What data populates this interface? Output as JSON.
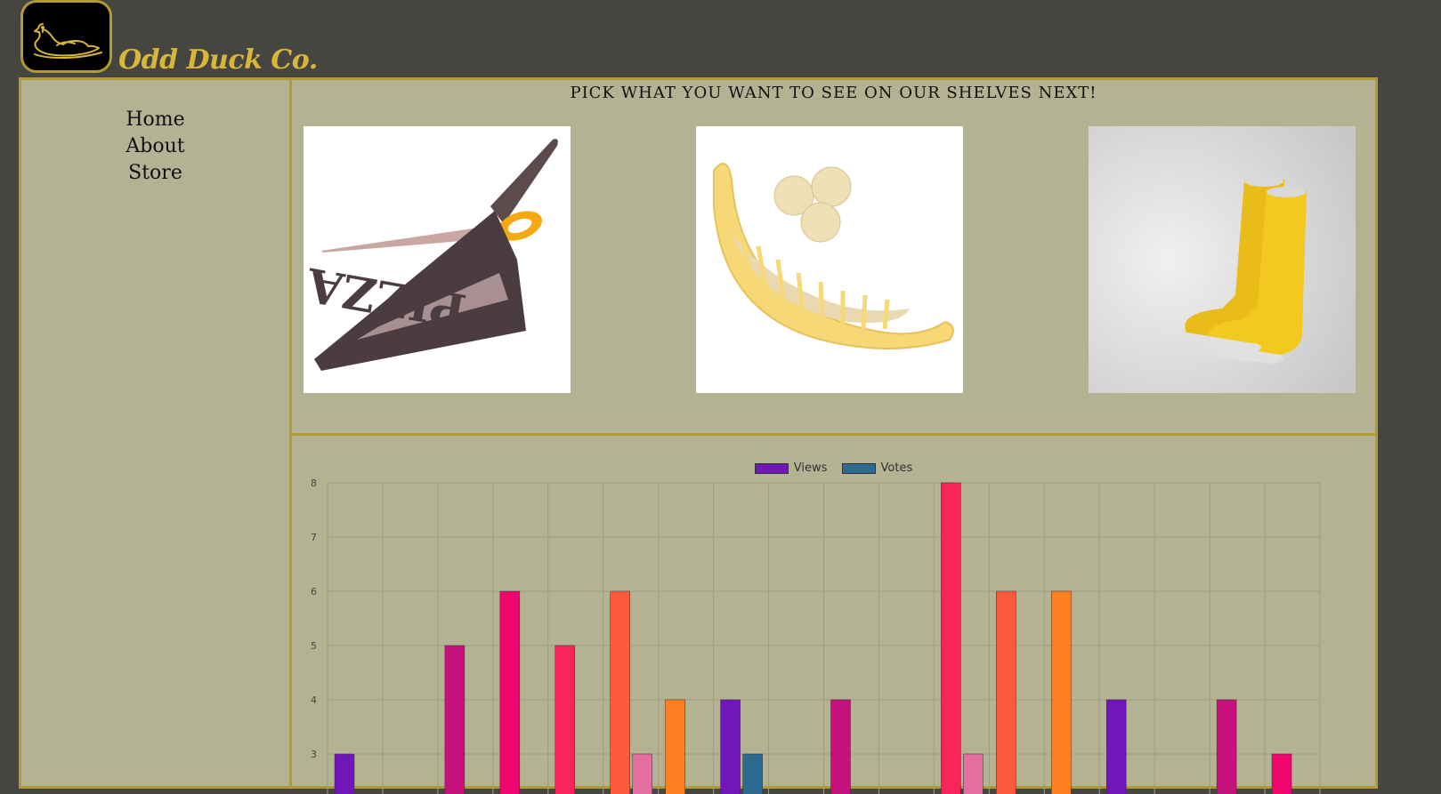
{
  "brand": {
    "name": "Odd Duck Co."
  },
  "nav": {
    "items": [
      {
        "label": "Home"
      },
      {
        "label": "About"
      },
      {
        "label": "Store"
      }
    ]
  },
  "picker": {
    "prompt": "PICK WHAT YOU WANT TO SEE ON OUR SHELVES NEXT!",
    "products": [
      {
        "icon": "pizza-scissors-icon"
      },
      {
        "icon": "banana-slicer-icon"
      },
      {
        "icon": "boots-icon"
      }
    ]
  },
  "chart_data": {
    "type": "bar",
    "series": [
      {
        "name": "Views",
        "values": [
          3,
          0,
          5,
          6,
          5,
          6,
          4,
          4,
          0,
          4,
          0,
          8,
          6,
          6,
          4,
          0,
          4,
          3
        ]
      },
      {
        "name": "Votes",
        "values": [
          0,
          0,
          0,
          0,
          0,
          3,
          0,
          3,
          0,
          0,
          0,
          3,
          0,
          0,
          0,
          0,
          0,
          0
        ]
      }
    ],
    "yticks": [
      "8",
      "7",
      "6",
      "5",
      "4",
      "3"
    ],
    "bar_colors": [
      "#7116b8",
      "#b3088f",
      "#c5117c",
      "#f0066e",
      "#f8245a",
      "#fd5a3c",
      "#fe8021",
      "#7116b8",
      "#c5117c",
      "#c5117c",
      "#f0066e",
      "#f8245a",
      "#fd5a3c",
      "#fe8021",
      "#7116b8",
      "#b3088f",
      "#c5117c",
      "#f0066e"
    ],
    "vote_color": "#2c6a8f",
    "vote_light_color": "#e56ea0",
    "legend_colors": {
      "views": "#7116b8",
      "votes": "#2c6a8f"
    },
    "ylim": [
      3,
      8
    ],
    "grid": true,
    "legend": "top-center"
  }
}
